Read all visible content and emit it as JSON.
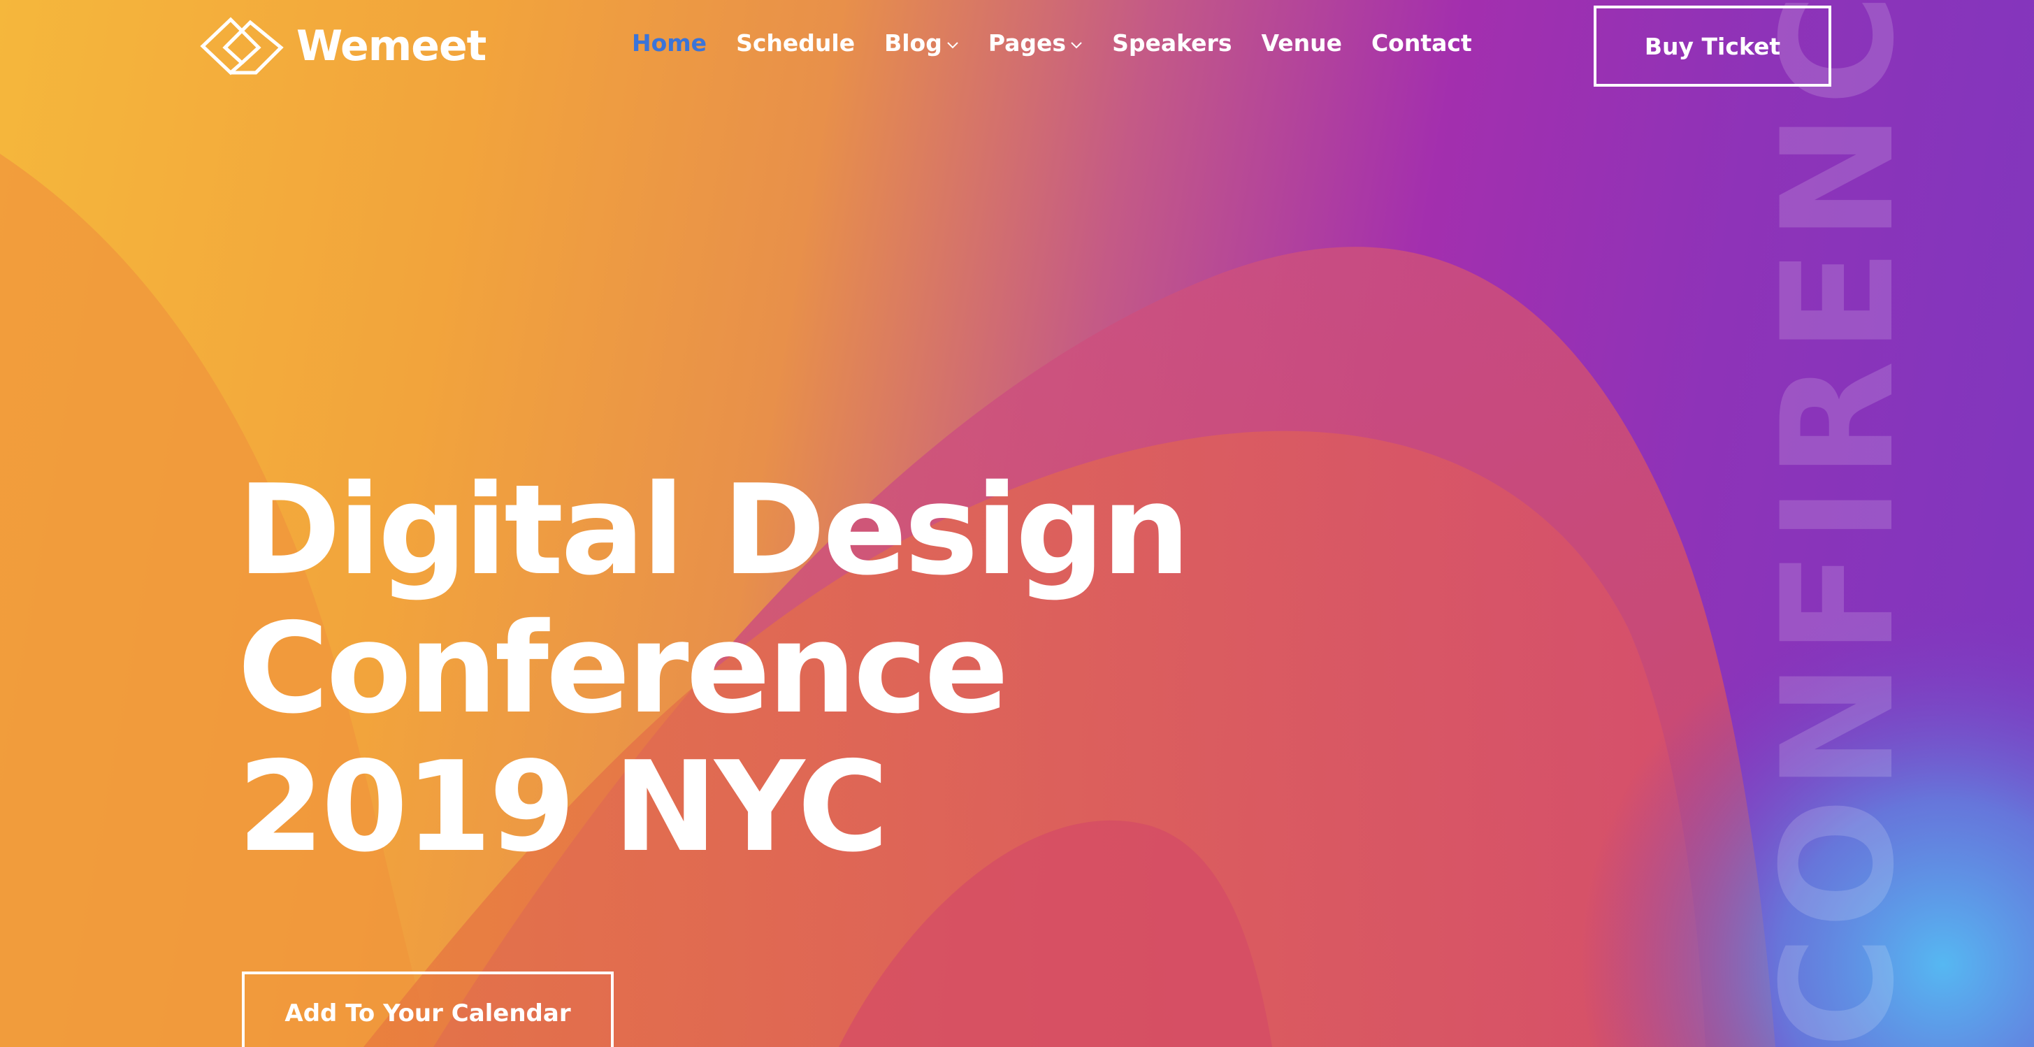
{
  "brand": {
    "name": "Wemeet",
    "logo_icon": "diamond-logo-icon"
  },
  "nav": {
    "items": [
      {
        "label": "Home",
        "active": true,
        "has_dropdown": false
      },
      {
        "label": "Schedule",
        "active": false,
        "has_dropdown": false
      },
      {
        "label": "Blog",
        "active": false,
        "has_dropdown": true
      },
      {
        "label": "Pages",
        "active": false,
        "has_dropdown": true
      },
      {
        "label": "Speakers",
        "active": false,
        "has_dropdown": false
      },
      {
        "label": "Venue",
        "active": false,
        "has_dropdown": false
      },
      {
        "label": "Contact",
        "active": false,
        "has_dropdown": false
      }
    ],
    "active_color": "#3b74d8"
  },
  "header": {
    "buy_label": "Buy Ticket"
  },
  "hero": {
    "title_lines": [
      "Digital Design",
      "Conference",
      "2019 NYC"
    ],
    "vertical_word": "CONFIRENCE",
    "cta_label": "Add To Your Calendar"
  },
  "colors": {
    "orange": "#f2a43c",
    "magenta": "#a32fae",
    "purple": "#7e37bf",
    "blue": "#56b8f2"
  }
}
